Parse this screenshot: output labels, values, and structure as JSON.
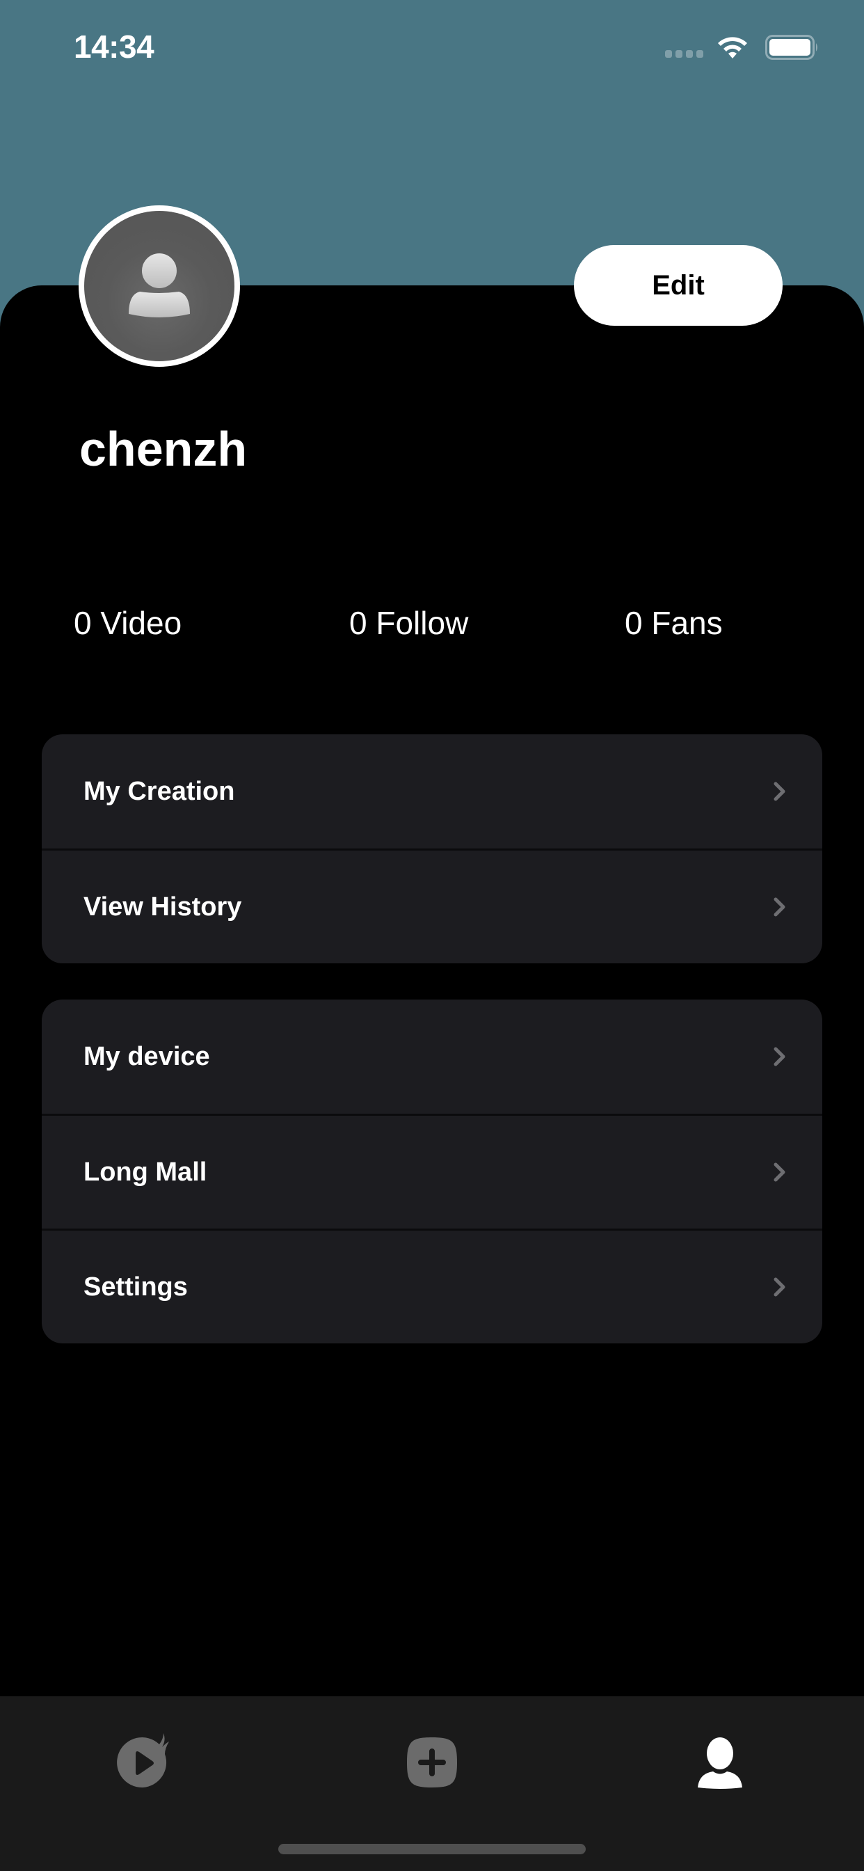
{
  "status_bar": {
    "time": "14:34",
    "signal_icon": "cellular-signal-icon",
    "wifi_icon": "wifi-icon",
    "battery_icon": "battery-icon"
  },
  "colors": {
    "header_background": "#497684",
    "page_background": "#000000",
    "card_background": "#1c1c20",
    "tab_bar_background": "#1a1a1a",
    "active_tab": "#ffffff",
    "inactive_tab": "#6b6b6b"
  },
  "profile": {
    "avatar_icon": "default-avatar-icon",
    "username": "chenzh",
    "edit_label": "Edit"
  },
  "stats": {
    "video": "0 Video",
    "follow": "0 Follow",
    "fans": "0 Fans"
  },
  "menu_groups": [
    {
      "items": [
        {
          "label": "My Creation",
          "icon": "chevron-right-icon"
        },
        {
          "label": "View History",
          "icon": "chevron-right-icon"
        }
      ]
    },
    {
      "items": [
        {
          "label": "My device",
          "icon": "chevron-right-icon"
        },
        {
          "label": "Long Mall",
          "icon": "chevron-right-icon"
        },
        {
          "label": "Settings",
          "icon": "chevron-right-icon"
        }
      ]
    }
  ],
  "tab_bar": {
    "tabs": [
      {
        "name": "home",
        "icon": "flame-play-icon",
        "active": false
      },
      {
        "name": "create",
        "icon": "plus-square-icon",
        "active": false
      },
      {
        "name": "profile",
        "icon": "user-icon",
        "active": true
      }
    ]
  }
}
